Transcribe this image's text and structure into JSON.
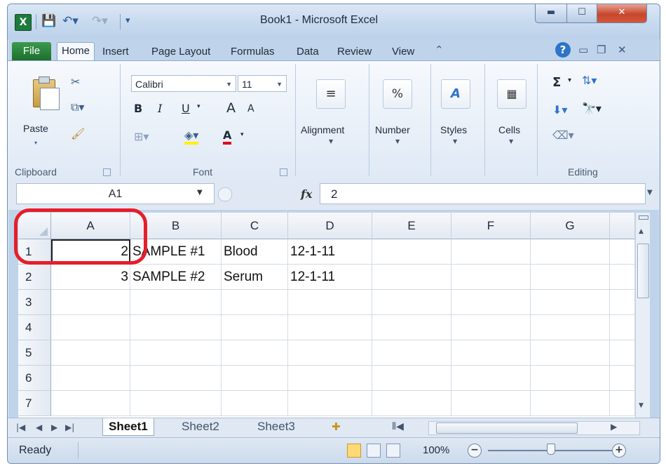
{
  "window": {
    "title": "Book1 - Microsoft Excel",
    "app_icon_label": "X"
  },
  "ribbon_tabs": [
    "File",
    "Home",
    "Insert",
    "Page Layout",
    "Formulas",
    "Data",
    "Review",
    "View"
  ],
  "ribbon": {
    "clipboard": {
      "paste": "Paste",
      "group": "Clipboard"
    },
    "font": {
      "name": "Calibri",
      "size": "11",
      "bold": "B",
      "italic": "I",
      "underline": "U",
      "grow": "A",
      "shrink": "A",
      "color": "A",
      "group": "Font"
    },
    "alignment": "Alignment",
    "number": {
      "label": "Number",
      "icon": "%"
    },
    "styles": "Styles",
    "cells": "Cells",
    "editing": {
      "group": "Editing",
      "sum": "Σ"
    }
  },
  "formula_bar": {
    "name_box": "A1",
    "fx": "fx",
    "value": "2"
  },
  "grid": {
    "columns": [
      "A",
      "B",
      "C",
      "D",
      "E",
      "F",
      "G"
    ],
    "rows": [
      "1",
      "2",
      "3",
      "4",
      "5",
      "6",
      "7"
    ],
    "data": [
      [
        "2",
        "SAMPLE #1",
        "Blood",
        "12-1-11"
      ],
      [
        "3",
        "SAMPLE #2",
        "Serum",
        "12-1-11"
      ]
    ]
  },
  "sheets": [
    "Sheet1",
    "Sheet2",
    "Sheet3"
  ],
  "status": {
    "text": "Ready",
    "zoom": "100%"
  },
  "colors": {
    "annotation": "#e61e2a",
    "file_tab": "#1d6e2e"
  }
}
